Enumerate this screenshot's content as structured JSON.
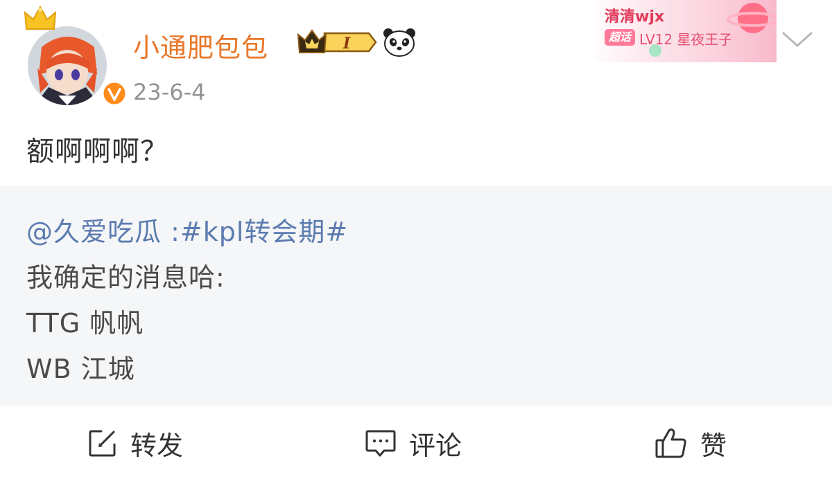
{
  "post": {
    "username": "小通肥包包",
    "vip_level": "I",
    "date": "23-6-4",
    "text": "额啊啊啊？"
  },
  "fan_card": {
    "name": "清清wjx",
    "tag": "超话",
    "level": "LV12 星夜王子"
  },
  "repost": {
    "mention": "@久爱吃瓜",
    "separator": " :",
    "hashtag": "#kpl转会期#",
    "line2": "我确定的消息哈:",
    "line3": "TTG 帆帆",
    "line4": "WB 江城"
  },
  "actions": {
    "repost_label": "转发",
    "comment_label": "评论",
    "like_label": "赞"
  },
  "colors": {
    "username": "#e8772a",
    "link": "#5b7bb0",
    "fan_name": "#e23a5a",
    "repost_bg": "#f5f6f7"
  },
  "icons": [
    "crown-icon",
    "verified-v-icon",
    "vip-crown-badge-icon",
    "panda-icon",
    "chevron-down-icon",
    "edit-repost-icon",
    "comment-icon",
    "thumbs-up-icon"
  ]
}
